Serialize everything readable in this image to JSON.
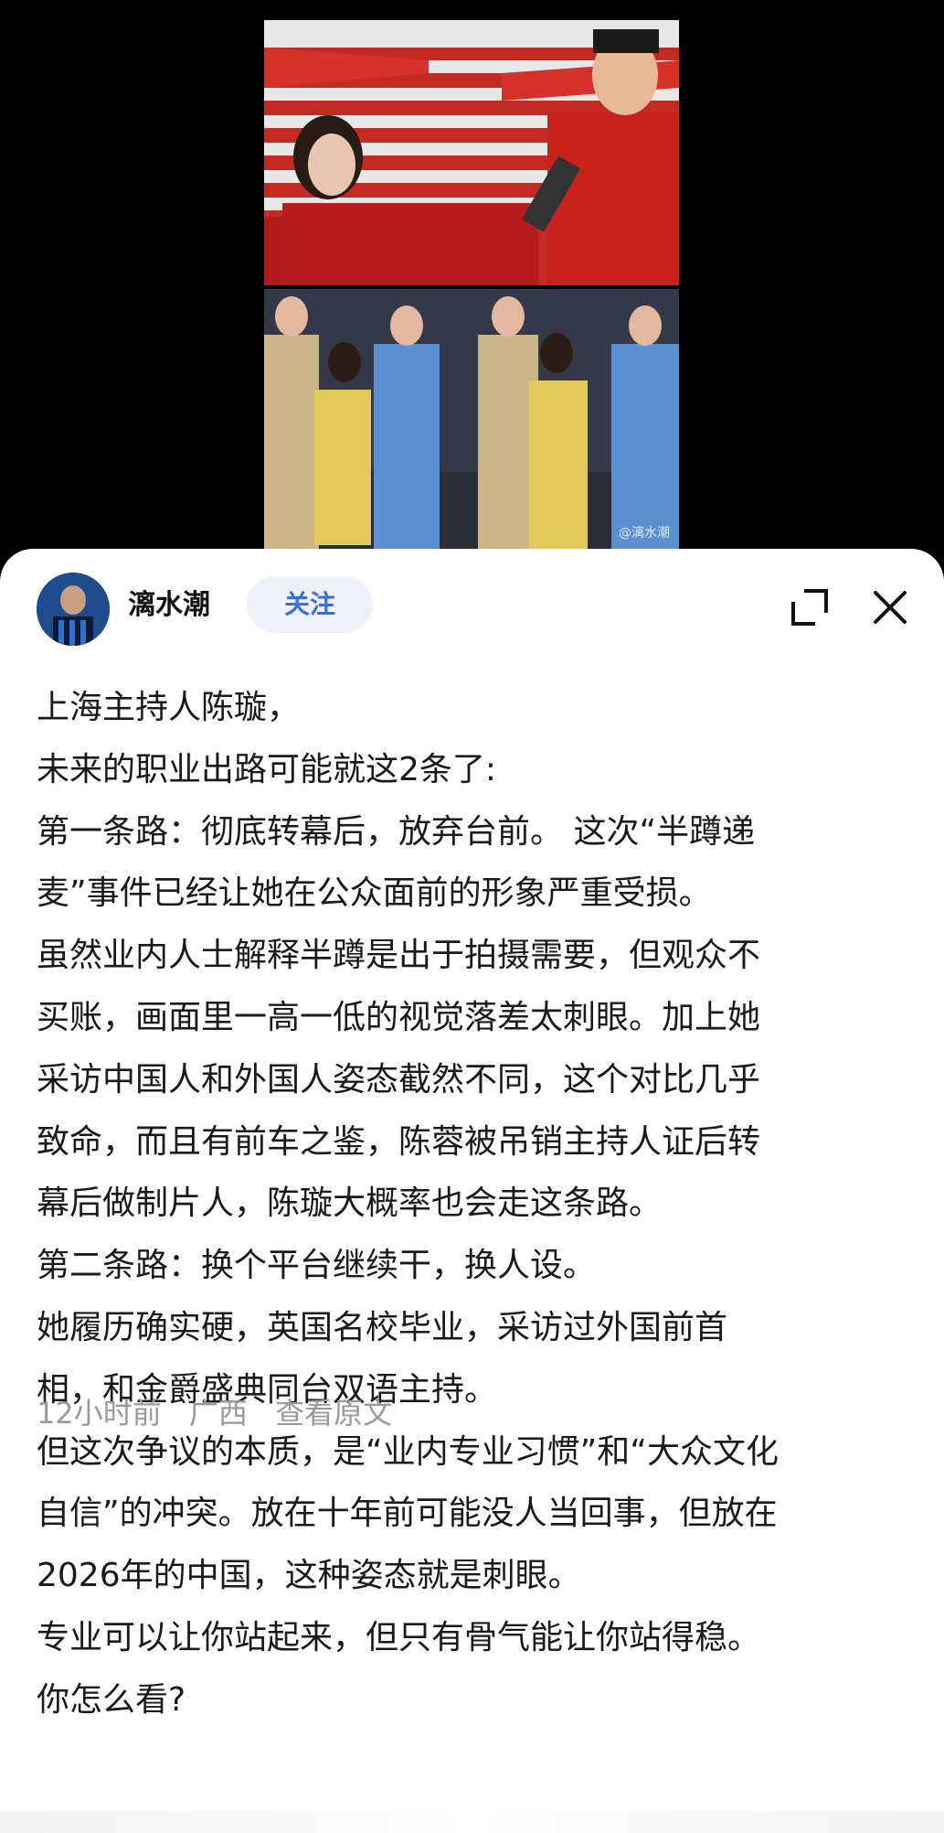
{
  "media": {
    "watermark": "@漓水潮"
  },
  "author": {
    "name": "漓水潮",
    "follow_label": "关注"
  },
  "icons": {
    "expand": "expand-icon",
    "close": "close-icon",
    "avatar": "avatar"
  },
  "post": {
    "lines": [
      "上海主持人陈璇，",
      "未来的职业出路可能就这2条了:",
      "第一条路：彻底转幕后，放弃台前。 这次“半蹲递",
      "麦”事件已经让她在公众面前的形象严重受损。",
      "虽然业内人士解释半蹲是出于拍摄需要，但观众不",
      "买账，画面里一高一低的视觉落差太刺眼。加上她",
      "采访中国人和外国人姿态截然不同，这个对比几乎",
      "致命，而且有前车之鉴，陈蓉被吊销主持人证后转",
      "幕后做制片人，陈璇大概率也会走这条路。",
      "第二条路：换个平台继续干，换人设。",
      "她履历确实硬，英国名校毕业，采访过外国前首",
      "相，和金爵盛典同台双语主持。",
      "但这次争议的本质，是“业内专业习惯”和“大众文化",
      "自信”的冲突。放在十年前可能没人当回事，但放在",
      "2026年的中国，这种姿态就是刺眼。",
      "专业可以让你站起来，但只有骨气能让你站得稳。",
      "你怎么看?"
    ]
  },
  "meta": {
    "time": "12小时前",
    "location": "广西",
    "view_original": "查看原文"
  },
  "colors": {
    "follow_text": "#3b6fd8",
    "follow_bg": "#eef1f7",
    "meta_text": "#9a9a9a",
    "body_text": "#1a1a1a"
  }
}
